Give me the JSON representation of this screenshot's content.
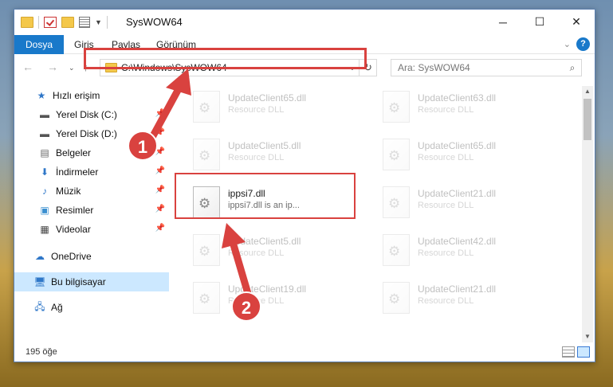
{
  "window": {
    "title": "SysWOW64"
  },
  "ribbon": {
    "tabs": [
      "Dosya",
      "Giriş",
      "Paylaş",
      "Görünüm"
    ]
  },
  "address": {
    "path": "C:\\Windows\\SysWOW64"
  },
  "search": {
    "placeholder": "Ara: SysWOW64"
  },
  "sidebar": {
    "items": [
      {
        "label": "Hızlı erişim",
        "icon": "star-icon"
      },
      {
        "label": "Yerel Disk (C:)",
        "icon": "drive-icon"
      },
      {
        "label": "Yerel Disk (D:)",
        "icon": "drive-icon"
      },
      {
        "label": "Belgeler",
        "icon": "documents-icon"
      },
      {
        "label": "İndirmeler",
        "icon": "download-icon"
      },
      {
        "label": "Müzik",
        "icon": "music-icon"
      },
      {
        "label": "Resimler",
        "icon": "pictures-icon"
      },
      {
        "label": "Videolar",
        "icon": "video-icon"
      },
      {
        "label": "OneDrive",
        "icon": "cloud-icon"
      },
      {
        "label": "Bu bilgisayar",
        "icon": "computer-icon"
      },
      {
        "label": "Ağ",
        "icon": "network-icon"
      }
    ]
  },
  "files": [
    {
      "name": "UpdateClient65.dll",
      "desc": "Resource DLL"
    },
    {
      "name": "UpdateClient63.dll",
      "desc": "Resource DLL"
    },
    {
      "name": "UpdateClient5.dll",
      "desc": "Resource DLL"
    },
    {
      "name": "UpdateClient65.dll",
      "desc": "Resource DLL"
    },
    {
      "name": "ippsi7.dll",
      "desc": "ippsi7.dll is an ip..."
    },
    {
      "name": "UpdateClient21.dll",
      "desc": "Resource DLL"
    },
    {
      "name": "UpdateClient5.dll",
      "desc": "Resource DLL"
    },
    {
      "name": "UpdateClient42.dll",
      "desc": "Resource DLL"
    },
    {
      "name": "UpdateClient19.dll",
      "desc": "Resource DLL"
    },
    {
      "name": "UpdateClient21.dll",
      "desc": "Resource DLL"
    }
  ],
  "status": {
    "count": "195 öğe"
  },
  "badges": {
    "one": "1",
    "two": "2"
  },
  "colors": {
    "accent": "#1979ca",
    "annotation": "#d9423f"
  }
}
